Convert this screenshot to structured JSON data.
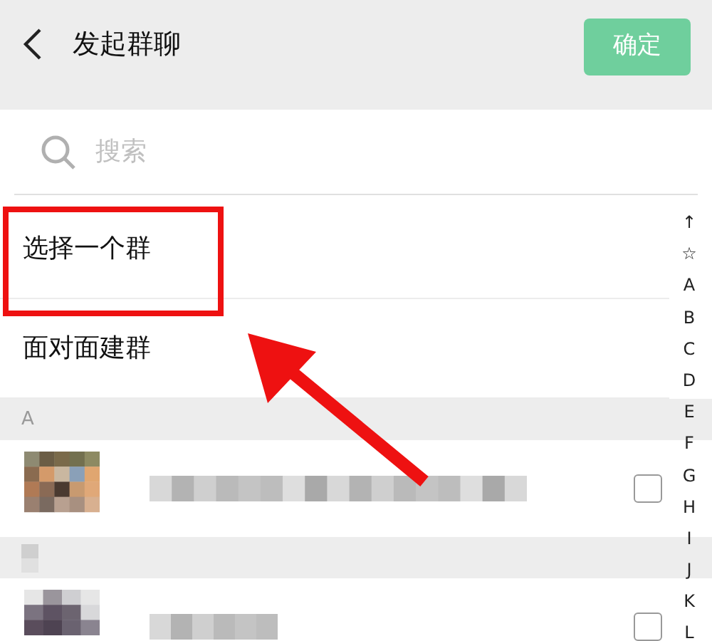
{
  "header": {
    "title": "发起群聊",
    "confirm": {
      "label": "确定",
      "disabled": true
    }
  },
  "search": {
    "placeholder": "搜索"
  },
  "options": [
    {
      "label": "选择一个群",
      "highlighted": true
    },
    {
      "label": "面对面建群",
      "highlighted": false
    }
  ],
  "sections": [
    {
      "letter": "A",
      "contacts": [
        {
          "checked": false
        }
      ]
    },
    {
      "contacts": [
        {
          "checked": false
        }
      ]
    }
  ],
  "index": [
    "↑",
    "☆",
    "A",
    "B",
    "C",
    "D",
    "E",
    "F",
    "G",
    "H",
    "I",
    "J",
    "K",
    "L"
  ]
}
